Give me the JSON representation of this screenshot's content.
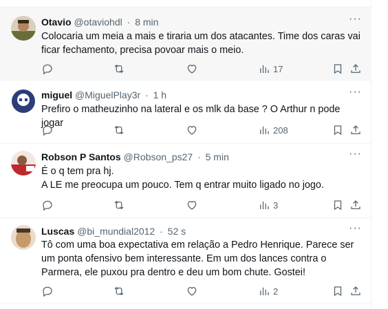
{
  "tweets": [
    {
      "name": "Otavio",
      "handle": "@otaviohdl",
      "time": "8 min",
      "text": "Colocaria um meia a mais e tiraria um dos atacantes. Time dos caras vai ficar fechamento, precisa povoar mais o meio.",
      "views": "17",
      "avatar_colors": [
        "#6b6b3a",
        "#d8d0b8"
      ]
    },
    {
      "name": "miguel",
      "handle": "@MiguelPlay3r",
      "time": "1 h",
      "text": "Prefiro o matheuzinho na lateral e os mlk da base ? O Arthur n pode jogar",
      "views": "208",
      "avatar_colors": [
        "#2c3e7a",
        "#ffffff"
      ]
    },
    {
      "name": "Robson P Santos",
      "handle": "@Robson_ps27",
      "time": "5 min",
      "text_lines": [
        "É o q tem pra hj.",
        "A LE me preocupa um pouco. Tem q entrar muito ligado no jogo."
      ],
      "views": "3",
      "avatar_colors": [
        "#c0282d",
        "#f2e6e0"
      ]
    },
    {
      "name": "Luscas",
      "handle": "@bi_mundial2012",
      "time": "52 s",
      "text": "Tô com uma boa expectativa em relação a Pedro Henrique. Parece ser um ponta ofensivo bem interessante. Em um dos lances contra o Parmera, ele puxou pra dentro e deu um bom chute. Gostei!",
      "views": "2",
      "avatar_colors": [
        "#c79a6a",
        "#e9dccb"
      ]
    }
  ],
  "icons": {
    "reply": "reply-icon",
    "retweet": "retweet-icon",
    "like": "heart-icon",
    "views": "views-icon",
    "bookmark": "bookmark-icon",
    "share": "share-icon",
    "more": "more-icon"
  },
  "more_glyph": "···",
  "dot": "·"
}
